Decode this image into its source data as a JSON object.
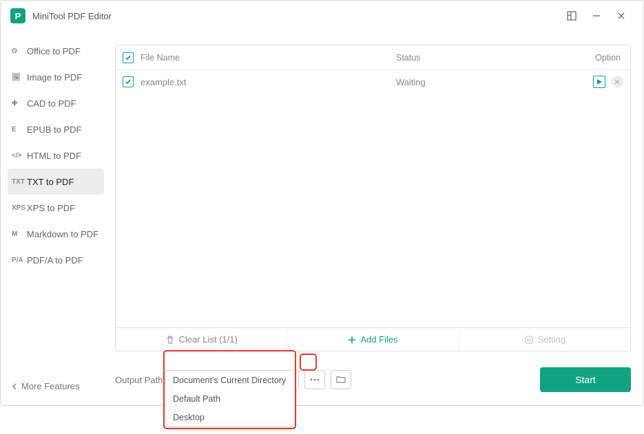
{
  "titlebar": {
    "app_name": "MiniTool PDF Editor",
    "icon_letter": "P"
  },
  "sidebar": {
    "items": [
      {
        "icon": "O",
        "label": "Office to PDF",
        "active": false
      },
      {
        "icon": "🖼",
        "label": "Image to PDF",
        "active": false
      },
      {
        "icon": "✚",
        "label": "CAD to PDF",
        "active": false
      },
      {
        "icon": "E",
        "label": "EPUB to PDF",
        "active": false
      },
      {
        "icon": "</>",
        "label": "HTML to PDF",
        "active": false
      },
      {
        "icon": "TXT",
        "label": "TXT to PDF",
        "active": true
      },
      {
        "icon": "XPS",
        "label": "XPS to PDF",
        "active": false
      },
      {
        "icon": "M",
        "label": "Markdown to PDF",
        "active": false
      },
      {
        "icon": "P/A",
        "label": "PDF/A to PDF",
        "active": false
      }
    ],
    "more": "More Features"
  },
  "file_table": {
    "headers": {
      "name": "File Name",
      "status": "Status",
      "option": "Option"
    },
    "rows": [
      {
        "name": "example.txt",
        "status": "Waiting"
      }
    ],
    "toolbar": {
      "clear": "Clear List (1/1)",
      "add": "Add Files",
      "setting": "Setting"
    }
  },
  "output": {
    "label": "Output Path:",
    "selected": "Document's Current Directory",
    "options": [
      "Document's Current Directory",
      "Default Path",
      "Desktop"
    ]
  },
  "buttons": {
    "start": "Start"
  }
}
